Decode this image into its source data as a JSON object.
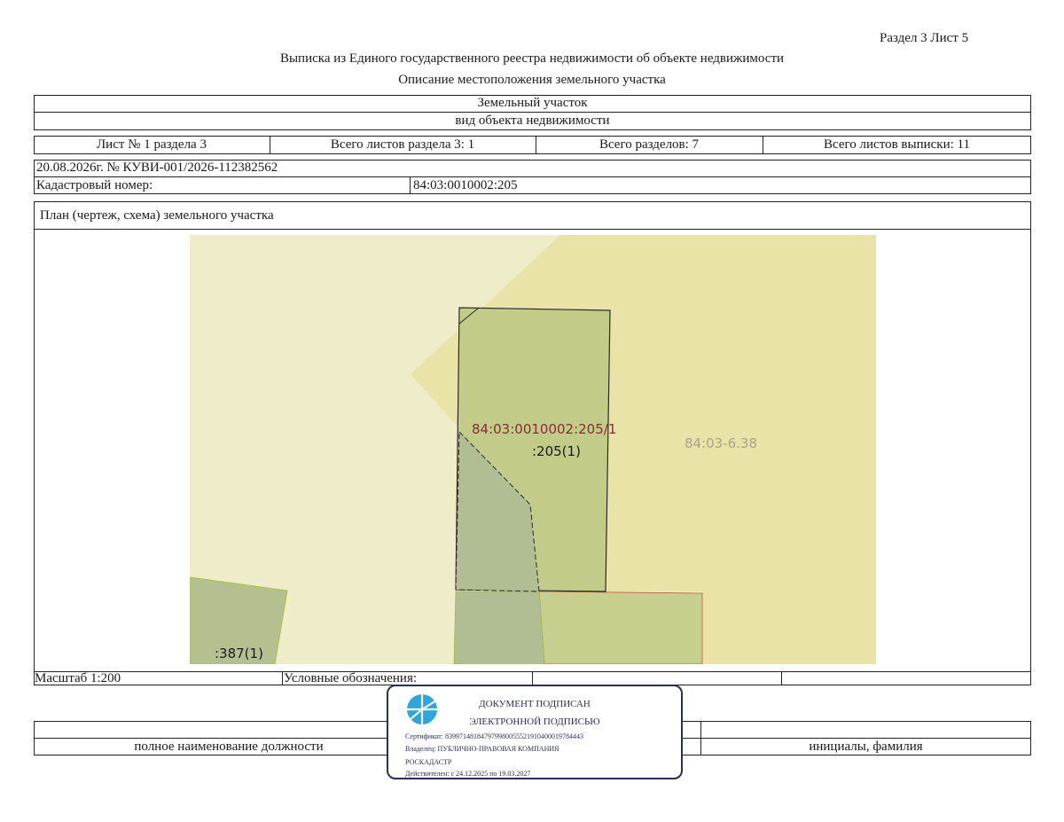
{
  "header": {
    "section_sheet": "Раздел 3    Лист 5",
    "title": "Выписка из Единого государственного реестра недвижимости об объекте недвижимости",
    "subtitle": "Описание местоположения земельного участка"
  },
  "object": {
    "name": "Земельный участок",
    "kind_caption": "вид объекта недвижимости"
  },
  "sheets_row": {
    "sheet": "Лист № 1 раздела 3",
    "total_section_sheets": "Всего листов раздела 3: 1",
    "total_sections": "Всего разделов: 7",
    "total_extract_sheets": "Всего листов выписки: 11"
  },
  "record": {
    "date_number": "20.08.2026г. № КУВИ-001/2026-112382562",
    "cadastral_label": "Кадастровый номер:",
    "cadastral_value": "84:03:0010002:205"
  },
  "plan": {
    "caption": "План (чертеж, схема) земельного участка",
    "labels": {
      "part_number": "84:03:0010002:205/1",
      "parcel_short": ":205(1)",
      "zone": "84:03-6.38",
      "neighbor": ":387(1)"
    },
    "colors": {
      "background": "#efedc9",
      "zone_fill": "#e9e3a7",
      "parcel_fill": "#c2cc88",
      "part_fill": "#b1bd92",
      "neighbor_fill": "#b4c090",
      "part_label": "#8a2a3a",
      "zone_label": "#a8a48a"
    }
  },
  "footer": {
    "scale": "Масштаб 1:200",
    "legend": "Условные обозначения:",
    "position_caption": "полное наименование должности",
    "initials_caption": "инициалы, фамилия"
  },
  "stamp": {
    "icon": "globe-logo-icon",
    "line1": "ДОКУМЕНТ ПОДПИСАН",
    "line2": "ЭЛЕКТРОННОЙ ПОДПИСЬЮ",
    "certificate": "Сертификат: 839971481847979980055521910400019784443",
    "owner": "Владелец: ПУБЛИЧНО-ПРАВОВАЯ КОМПАНИЯ",
    "owner2": "РОСКАДАСТР",
    "validity": "Действителен: с 24.12.2025 по 19.03.2027"
  }
}
